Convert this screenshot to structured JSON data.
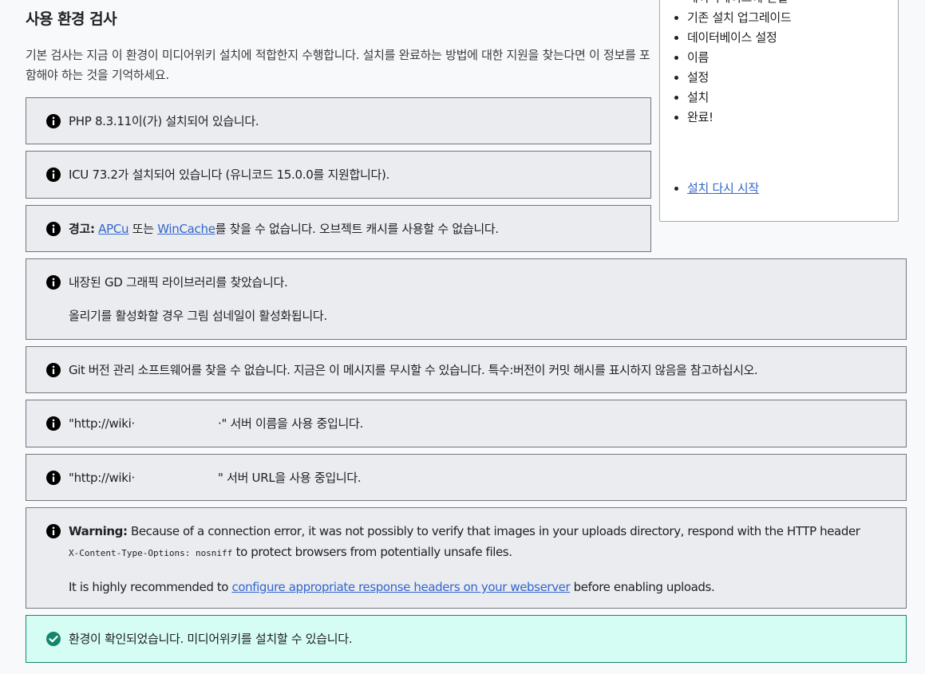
{
  "heading": "사용 환경 검사",
  "intro": "기본 검사는 지금 이 환경이 미디어위키 설치에 적합한지 수행합니다. 설치를 완료하는 방법에 대한 지원을 찾는다면 이 정보를 포함해야 하는 것을 기억하세요.",
  "sidebar": {
    "steps": [
      "데이터베이스에 연결",
      "기존 설치 업그레이드",
      "데이터베이스 설정",
      "이름",
      "설정",
      "설치",
      "완료!"
    ],
    "restart_label": "설치 다시 시작"
  },
  "messages": {
    "php": "PHP 8.3.11이(가) 설치되어 있습니다.",
    "icu": "ICU 73.2가 설치되어 있습니다 (유니코드 15.0.0를 지원합니다).",
    "apcu": {
      "label": "경고:",
      "link1": "APCu",
      "mid": " 또는 ",
      "link2": "WinCache",
      "rest": "를 찾을 수 없습니다. 오브젝트 캐시를 사용할 수 없습니다."
    },
    "gd": {
      "line1": "내장된 GD 그래픽 라이브러리를 찾았습니다.",
      "line2": "올리기를 활성화할 경우 그림 섬네일이 활성화됩니다."
    },
    "git": "Git 버전 관리 소프트웨어를 찾을 수 없습니다. 지금은 이 메시지를 무시할 수 있습니다. 특수:버전이 커밋 해시를 표시하지 않음을 참고하십시오.",
    "server_name": {
      "prefix": "\"http://wiki·",
      "suffix": "·\" 서버 이름을 사용 중입니다."
    },
    "server_url": {
      "prefix": "\"http://wiki·",
      "suffix": "\" 서버 URL을 사용 중입니다."
    },
    "warning": {
      "label": "Warning:",
      "text1": " Because of a connection error, it was not possibly to verify that images in your uploads directory, respond with the HTTP header",
      "code": "X-Content-Type-Options: nosniff",
      "text2": " to protect browsers from potentially unsafe files.",
      "rec_prefix": "It is highly recommended to ",
      "rec_link": "configure appropriate response headers on your webserver",
      "rec_suffix": " before enabling uploads."
    },
    "success": "환경이 확인되었습니다. 미디어위키를 설치할 수 있습니다."
  }
}
